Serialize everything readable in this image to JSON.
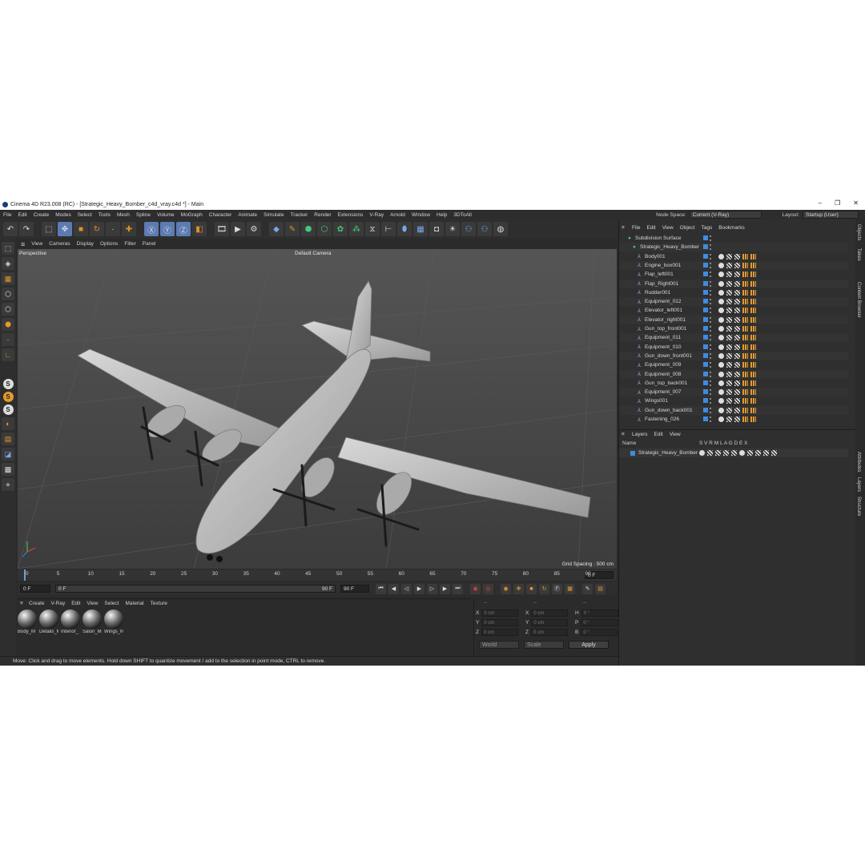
{
  "window": {
    "title": "Cinema 4D R23.008 (RC) - [Strategic_Heavy_Bomber_c4d_vray.c4d *] - Main",
    "controls": [
      "–",
      "❐",
      "✕"
    ]
  },
  "menubar": [
    "File",
    "Edit",
    "Create",
    "Modes",
    "Select",
    "Tools",
    "Mesh",
    "Spline",
    "Volume",
    "MoGraph",
    "Character",
    "Animate",
    "Simulate",
    "Tracker",
    "Render",
    "Extensions",
    "V-Ray",
    "Arnold",
    "Window",
    "Help",
    "3DToAll"
  ],
  "node_space": {
    "label": "Node Space:",
    "value": "Current (V-Ray)"
  },
  "layout": {
    "label": "Layout:",
    "value": "Startup (User)"
  },
  "viewport": {
    "menu": [
      "View",
      "Cameras",
      "Display",
      "Options",
      "Filter",
      "Panel"
    ],
    "name": "Perspective",
    "camera": "Default Camera",
    "grid_spacing": "Grid Spacing : 500 cm"
  },
  "timeline": {
    "ticks": [
      "0",
      "5",
      "10",
      "15",
      "20",
      "25",
      "30",
      "35",
      "40",
      "45",
      "50",
      "55",
      "60",
      "65",
      "70",
      "75",
      "80",
      "85",
      "90"
    ],
    "end_frame": "0 F",
    "current_frame": "0 F",
    "range_start": "0 F",
    "range_end": "90 F",
    "max_frame": "90 F"
  },
  "materials": {
    "menu": [
      "Create",
      "V-Ray",
      "Edit",
      "View",
      "Select",
      "Material",
      "Texture"
    ],
    "items": [
      "Body_M",
      "Details_M",
      "Interior_",
      "Salon_M",
      "Wings_M"
    ]
  },
  "coordinates": {
    "header": [
      "--",
      "--",
      "--"
    ],
    "rows": [
      {
        "a": "X",
        "av": "0 cm",
        "b": "X",
        "bv": "0 cm",
        "c": "H",
        "cv": "0 °"
      },
      {
        "a": "Y",
        "av": "0 cm",
        "b": "Y",
        "bv": "0 cm",
        "c": "P",
        "cv": "0 °"
      },
      {
        "a": "Z",
        "av": "0 cm",
        "b": "Z",
        "bv": "0 cm",
        "c": "B",
        "cv": "0 °"
      }
    ],
    "mode": "World",
    "scale": "Scale",
    "apply": "Apply"
  },
  "status": "Move: Click and drag to move elements. Hold down SHIFT to quantize movement / add to the selection in point mode, CTRL to remove.",
  "objects": {
    "menu": [
      "File",
      "Edit",
      "View",
      "Object",
      "Tags",
      "Bookmarks"
    ],
    "root": "Subdivision Surface",
    "group": "Strategic_Heavy_Bomber",
    "children": [
      "Body001",
      "Engine_box001",
      "Flap_left001",
      "Flap_Right001",
      "Rudder001",
      "Equipment_012",
      "Elevator_left001",
      "Elevator_right001",
      "Gun_top_front001",
      "Equipment_011",
      "Equipment_010",
      "Gun_down_front001",
      "Equipment_009",
      "Equipment_008",
      "Gun_top_back001",
      "Equipment_007",
      "Wings001",
      "Gun_down_back001",
      "Fastening_026"
    ]
  },
  "layers": {
    "menu": [
      "Layers",
      "Edit",
      "View"
    ],
    "columns": {
      "name": "Name",
      "flags": "S  V  R  M  L  A  G  D  E  X"
    },
    "rows": [
      "Strategic_Heavy_Bomber"
    ]
  },
  "side_tabs": [
    "Objects",
    "Takes",
    "Content Browser",
    "Attributes",
    "Layers",
    "Structure"
  ],
  "colors": {
    "accent": "#5c7bb4",
    "tag_blue": "#3e8ce0",
    "orange": "#e49a2c"
  }
}
